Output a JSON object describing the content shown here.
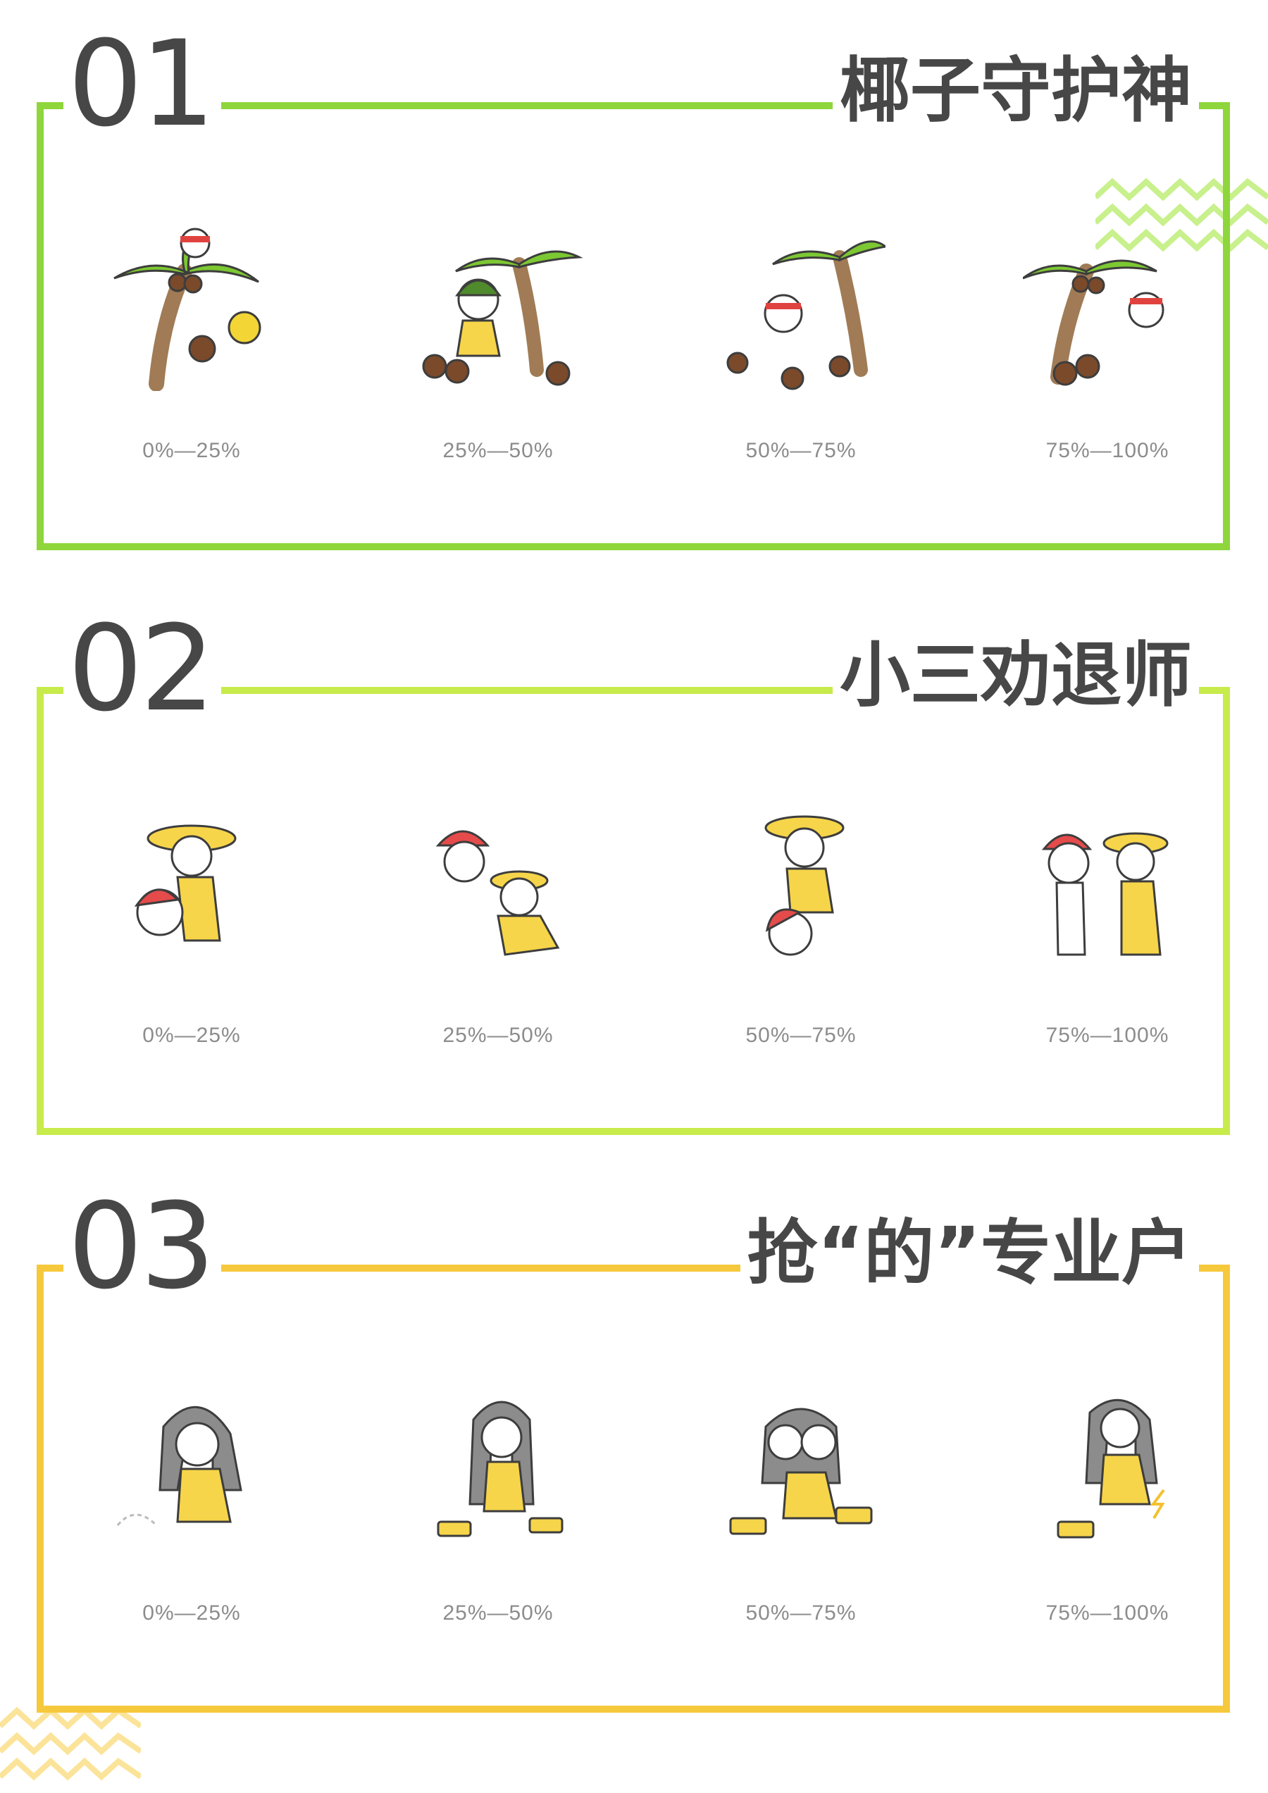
{
  "sections": [
    {
      "number": "01",
      "title": "椰子守护神",
      "accent": "#8ed63b",
      "panels": [
        {
          "range": "0%—25%",
          "art": "coconut-tree-icon"
        },
        {
          "range": "25%—50%",
          "art": "coconut-tree-icon"
        },
        {
          "range": "50%—75%",
          "art": "coconut-tree-icon"
        },
        {
          "range": "75%—100%",
          "art": "coconut-tree-icon"
        }
      ]
    },
    {
      "number": "02",
      "title": "小三劝退师",
      "accent": "#c7eb4a",
      "panels": [
        {
          "range": "0%—25%",
          "art": "couple-figures-icon"
        },
        {
          "range": "25%—50%",
          "art": "couple-figures-icon"
        },
        {
          "range": "50%—75%",
          "art": "couple-figures-icon"
        },
        {
          "range": "75%—100%",
          "art": "couple-figures-icon"
        }
      ]
    },
    {
      "number": "03",
      "title": "抢“的”专业户",
      "accent": "#f6c93c",
      "panels": [
        {
          "range": "0%—25%",
          "art": "girl-taxi-icon"
        },
        {
          "range": "25%—50%",
          "art": "girl-taxi-icon"
        },
        {
          "range": "50%—75%",
          "art": "girl-taxi-icon"
        },
        {
          "range": "75%—100%",
          "art": "girl-taxi-icon"
        }
      ]
    }
  ],
  "decorations": {
    "top_right_zigzag_color": "#c8f08c",
    "bottom_left_zigzag_color": "#fbe49a"
  }
}
